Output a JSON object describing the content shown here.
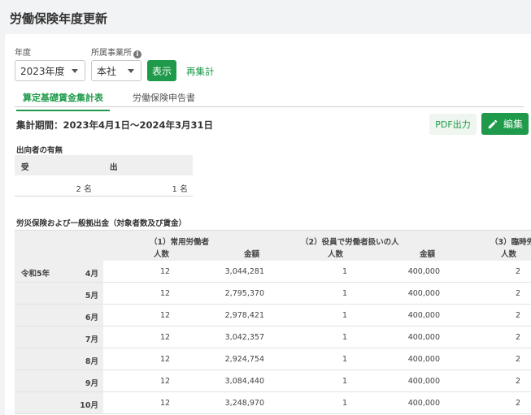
{
  "page": {
    "title": "労働保険年度更新"
  },
  "filters": {
    "year_label": "年度",
    "year_value": "2023年度",
    "office_label": "所属事業所",
    "office_info_icon": "info-icon",
    "office_value": "本社",
    "show_button": "表示",
    "recalc_link": "再集計"
  },
  "tabs": [
    "算定基礎賃金集計表",
    "労働保険申告書"
  ],
  "period": "集計期間：2023年4月1日〜2024年3月31日",
  "actions": {
    "pdf_label": "PDF出力",
    "edit_label": "編集",
    "edit_icon": "pencil-icon"
  },
  "secondment": {
    "title": "出向者の有無",
    "col_receive": "受",
    "col_send": "出",
    "receive_value": "2 名",
    "send_value": "1 名"
  },
  "main_table": {
    "title": "労災保険および一般拠出金（対象者数及び賃金）",
    "groups": [
      {
        "label": "（1）常用労働者",
        "count_header": "人数",
        "amount_header": "金額"
      },
      {
        "label": "（2）役員で労働者扱いの人",
        "count_header": "人数",
        "amount_header": "金額"
      },
      {
        "label": "（3）臨時労",
        "count_header": "人数"
      }
    ],
    "era": "令和5年",
    "rows": [
      {
        "month": "4月",
        "c1": "12",
        "a1": "3,044,281",
        "c2": "1",
        "a2": "400,000",
        "c3": "2"
      },
      {
        "month": "5月",
        "c1": "12",
        "a1": "2,795,370",
        "c2": "1",
        "a2": "400,000",
        "c3": "2"
      },
      {
        "month": "6月",
        "c1": "12",
        "a1": "2,978,421",
        "c2": "1",
        "a2": "400,000",
        "c3": "2"
      },
      {
        "month": "7月",
        "c1": "12",
        "a1": "3,042,357",
        "c2": "1",
        "a2": "400,000",
        "c3": "2"
      },
      {
        "month": "8月",
        "c1": "12",
        "a1": "2,924,754",
        "c2": "1",
        "a2": "400,000",
        "c3": "2"
      },
      {
        "month": "9月",
        "c1": "12",
        "a1": "3,084,440",
        "c2": "1",
        "a2": "400,000",
        "c3": "2"
      },
      {
        "month": "10月",
        "c1": "12",
        "a1": "3,248,970",
        "c2": "1",
        "a2": "400,000",
        "c3": "2"
      }
    ]
  },
  "colors": {
    "accent": "#1e9a4a",
    "header_bg": "#efefef"
  }
}
